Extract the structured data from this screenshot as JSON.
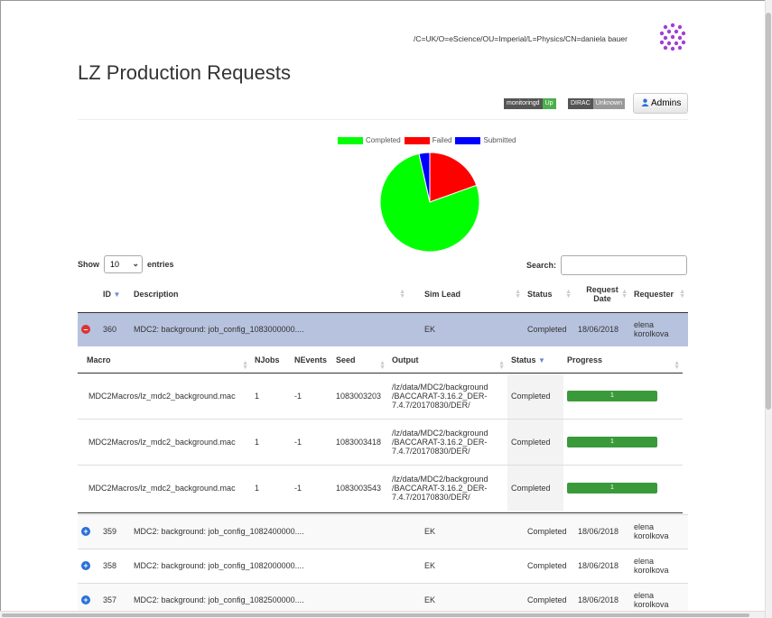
{
  "user": {
    "dn": "/C=UK/O=eScience/OU=Imperial/L=Physics/CN=daniela bauer"
  },
  "page": {
    "title": "LZ Production Requests"
  },
  "badges": [
    {
      "key": "monitoringd",
      "value": "Up",
      "color": "#4cae4c"
    },
    {
      "key": "DIRAC",
      "value": "Unknown",
      "color": "#999999"
    }
  ],
  "admins_button": {
    "label": "Admins"
  },
  "chart_data": {
    "type": "pie",
    "legend": [
      "Completed",
      "Failed",
      "Submitted"
    ],
    "colors": [
      "#00ff00",
      "#ff0000",
      "#0000ff"
    ],
    "values": [
      77,
      19.5,
      3.5
    ]
  },
  "controls": {
    "show_label": "Show",
    "entries_value": "10",
    "entries_label": "entries",
    "search_label": "Search:",
    "search_value": ""
  },
  "main_table": {
    "headers": [
      "ID",
      "Description",
      "Sim Lead",
      "Status",
      "Request Date",
      "Requester"
    ],
    "rows": [
      {
        "id": "360",
        "description": "MDC2: background: job_config_1083000000....",
        "sim_lead": "EK",
        "status": "Completed",
        "date": "18/06/2018",
        "requester": "elena korolkova",
        "expanded": true
      },
      {
        "id": "359",
        "description": "MDC2: background: job_config_1082400000....",
        "sim_lead": "EK",
        "status": "Completed",
        "date": "18/06/2018",
        "requester": "elena korolkova",
        "expanded": false
      },
      {
        "id": "358",
        "description": "MDC2: background: job_config_1082000000....",
        "sim_lead": "EK",
        "status": "Completed",
        "date": "18/06/2018",
        "requester": "elena korolkova",
        "expanded": false
      },
      {
        "id": "357",
        "description": "MDC2: background: job_config_1082500000....",
        "sim_lead": "EK",
        "status": "Completed",
        "date": "18/06/2018",
        "requester": "elena korolkova",
        "expanded": false
      }
    ]
  },
  "sub_table": {
    "headers": [
      "Macro",
      "NJobs",
      "NEvents",
      "Seed",
      "Output",
      "Status",
      "Progress"
    ],
    "rows": [
      {
        "macro": "MDC2Macros/lz_mdc2_background.mac",
        "njobs": "1",
        "nevents": "-1",
        "seed": "1083003203",
        "output": "/lz/data/MDC2/background /BACCARAT-3.16.2_DER-7.4.7/20170830/DER/",
        "status": "Completed",
        "progress_label": "1",
        "progress": 1.0
      },
      {
        "macro": "MDC2Macros/lz_mdc2_background.mac",
        "njobs": "1",
        "nevents": "-1",
        "seed": "1083003418",
        "output": "/lz/data/MDC2/background /BACCARAT-3.16.2_DER-7.4.7/20170830/DER/",
        "status": "Completed",
        "progress_label": "1",
        "progress": 1.0
      },
      {
        "macro": "MDC2Macros/lz_mdc2_background.mac",
        "njobs": "1",
        "nevents": "-1",
        "seed": "1083003543",
        "output": "/lz/data/MDC2/background /BACCARAT-3.16.2_DER-7.4.7/20170830/DER/",
        "status": "Completed",
        "progress_label": "1",
        "progress": 1.0
      }
    ]
  }
}
